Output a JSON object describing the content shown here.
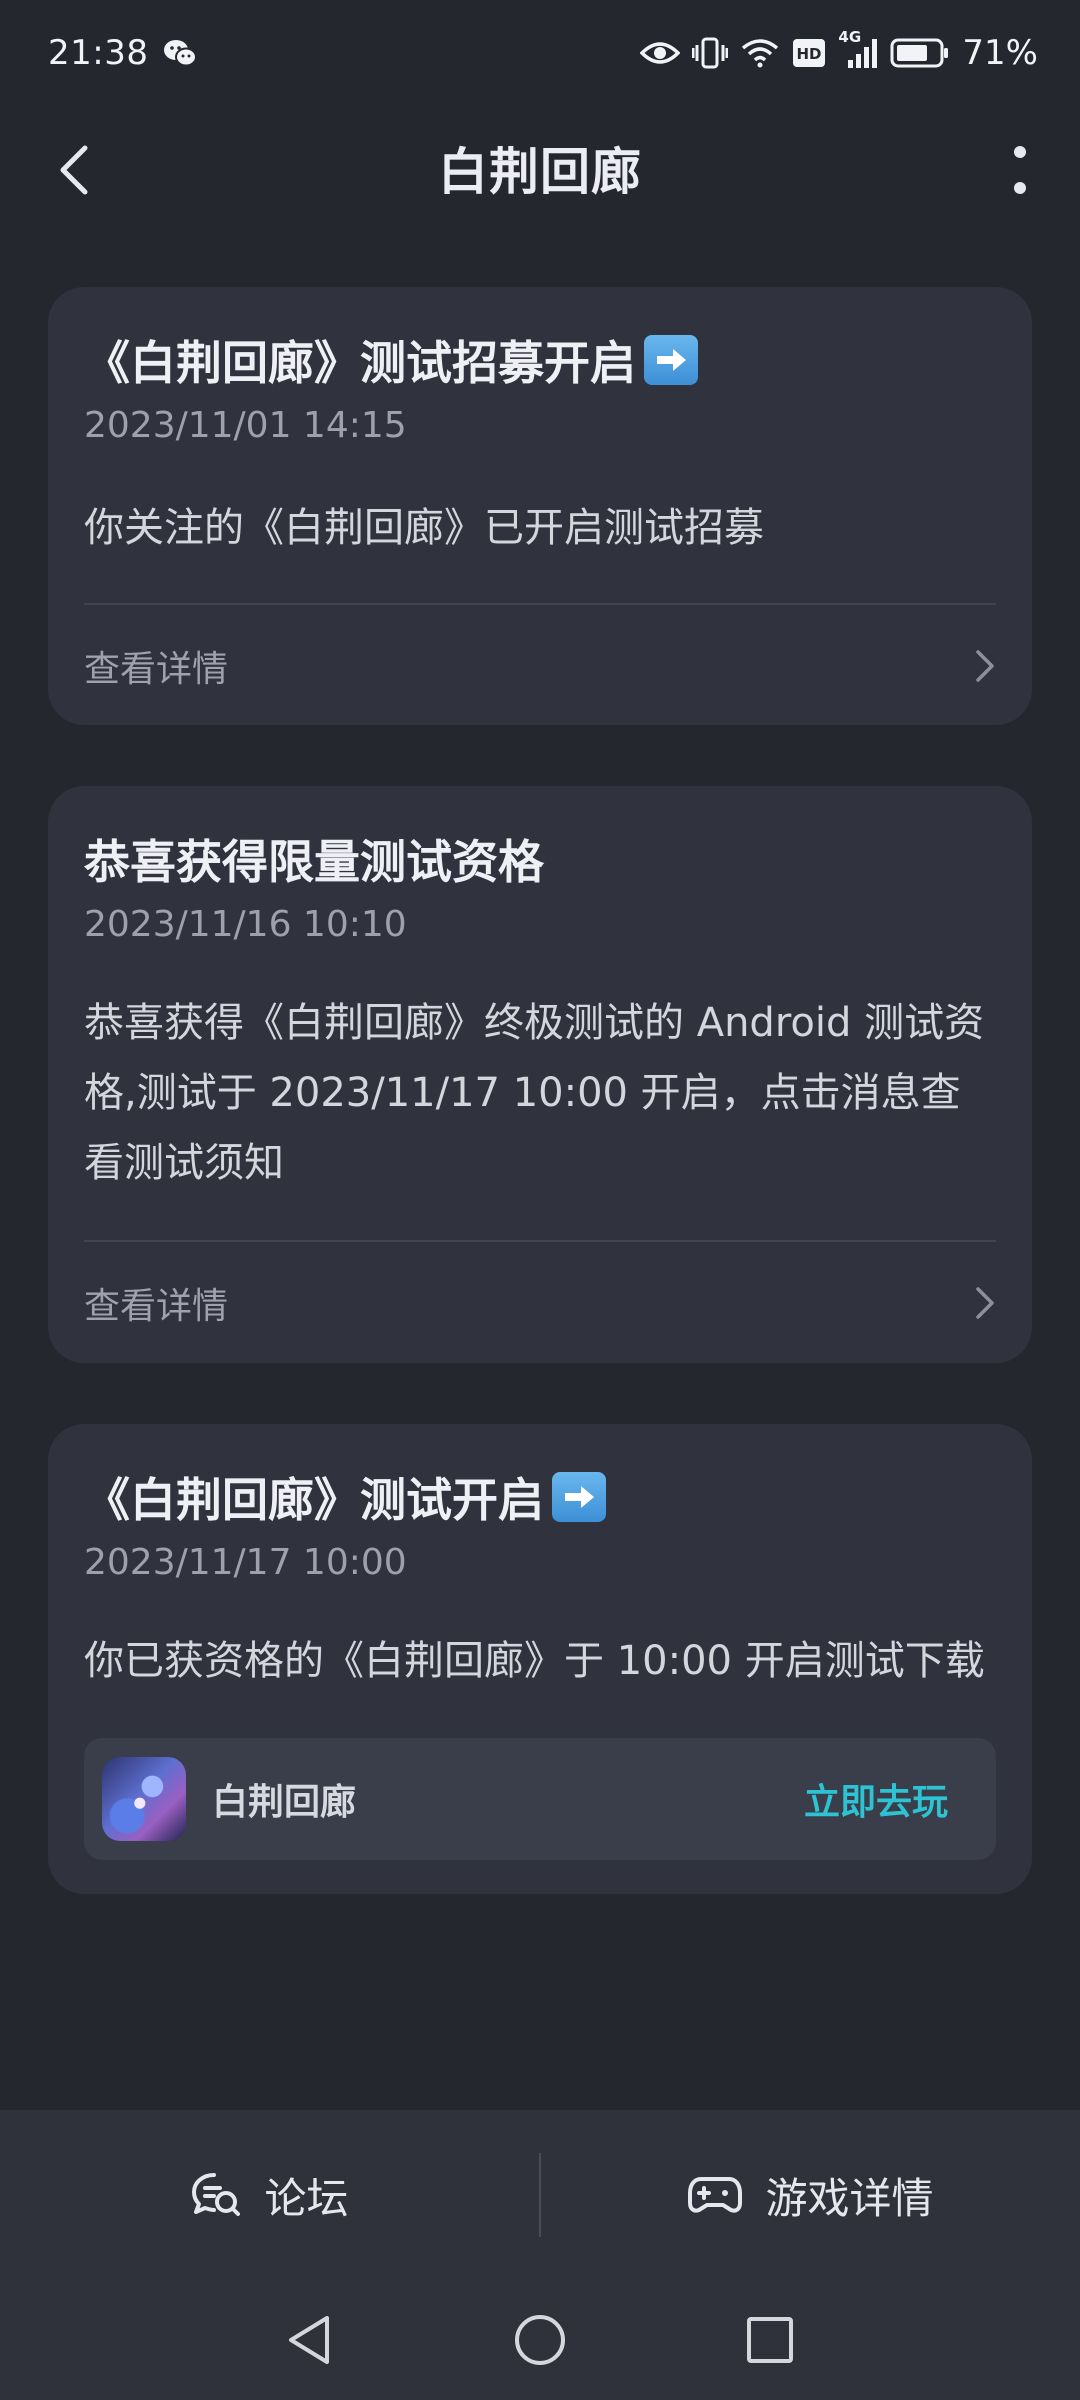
{
  "status_bar": {
    "time": "21:38",
    "network": "4G",
    "hd": "HD",
    "battery": "71%",
    "icons": [
      "wechat-icon",
      "eye-icon",
      "vibrate-icon",
      "wifi-icon",
      "signal-icon",
      "battery-icon"
    ]
  },
  "header": {
    "title": "白荆回廊",
    "icons": [
      "back-arrow-icon",
      "more-vertical-icon"
    ]
  },
  "messages": [
    {
      "title": "《白荆回廊》测试招募开启",
      "title_emoji": "arrow-right-emoji",
      "date": "2023/11/01 14:15",
      "body": "你关注的《白荆回廊》已开启测试招募",
      "action_label": "查看详情"
    },
    {
      "title": "恭喜获得限量测试资格",
      "date": "2023/11/16 10:10",
      "body_lines": [
        "恭喜获得《白荆回廊》终极测试的 Android 测试资",
        "格,测试于 2023/11/17 10:00 开启，点击消息查",
        "看测试须知"
      ],
      "action_label": "查看详情"
    },
    {
      "title": "《白荆回廊》测试开启",
      "title_emoji": "arrow-right-emoji",
      "date": "2023/11/17 10:00",
      "body": "你已获资格的《白荆回廊》于 10:00 开启测试下载",
      "game": {
        "name": "白荆回廊",
        "play_label": "立即去玩"
      }
    }
  ],
  "bottom_bar": {
    "forum_label": "论坛",
    "game_detail_label": "游戏详情"
  },
  "colors": {
    "background": "#25272f",
    "card": "#30323d",
    "accent": "#2ec3d3"
  }
}
